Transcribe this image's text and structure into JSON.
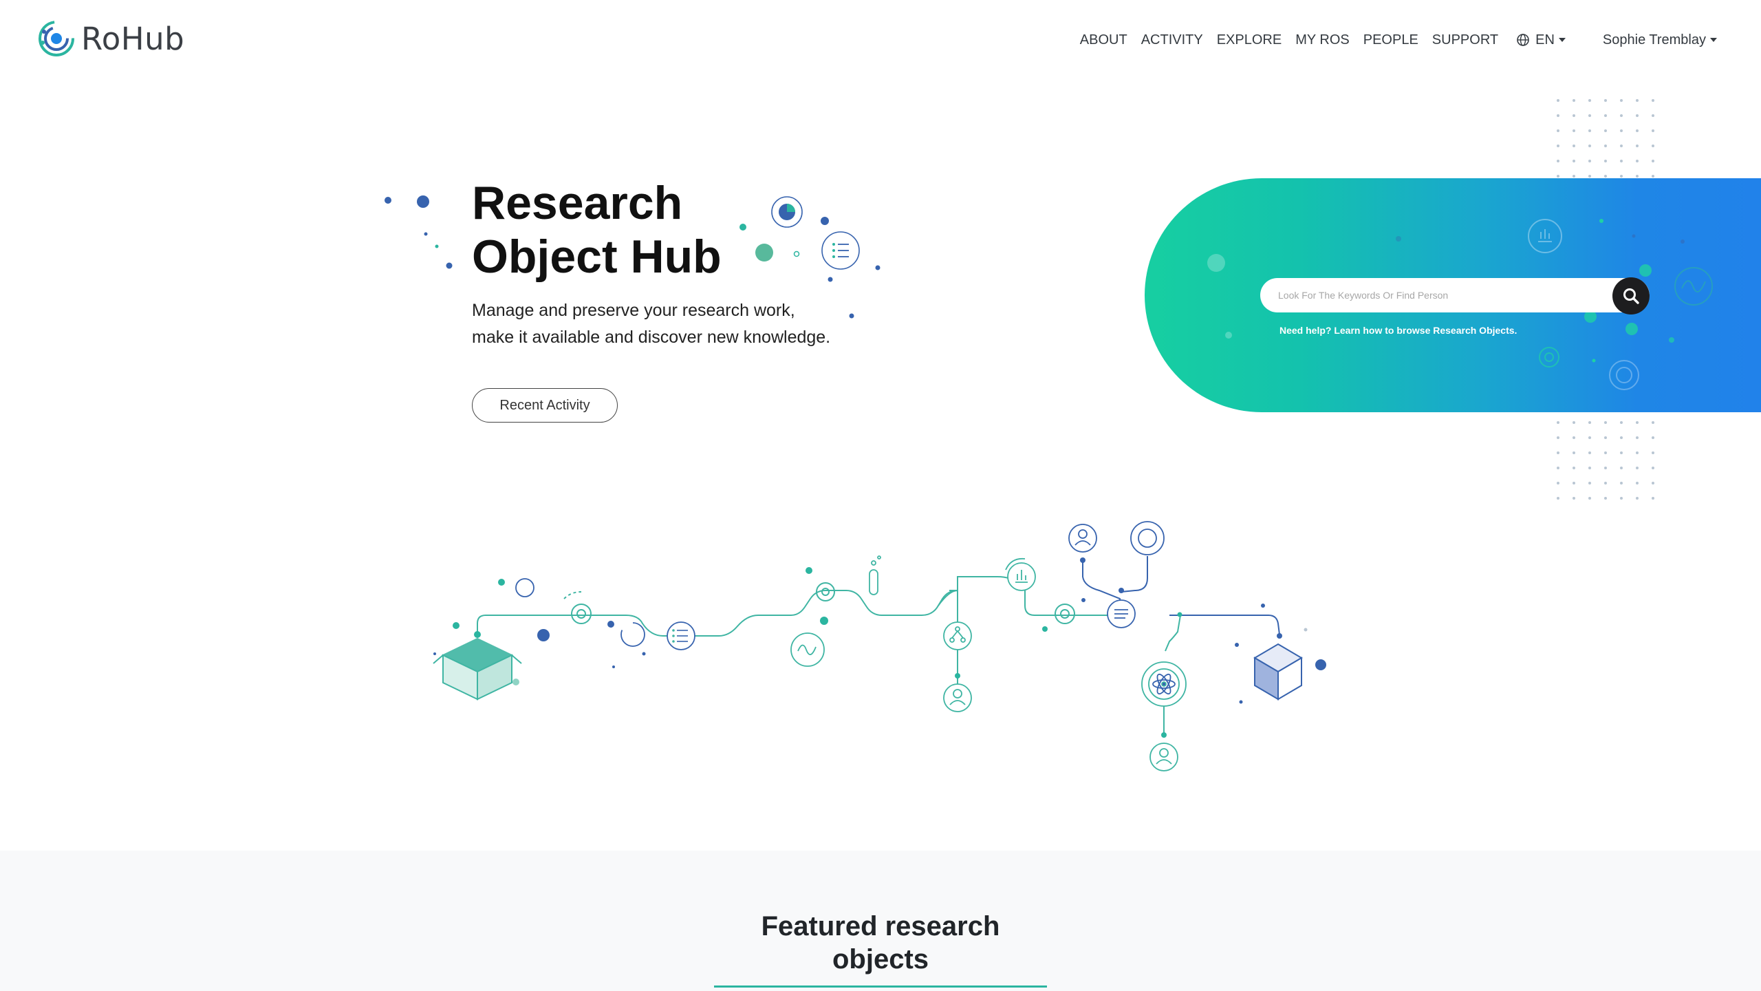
{
  "brand": {
    "name": "RoHub"
  },
  "nav": {
    "links": [
      {
        "label": "ABOUT"
      },
      {
        "label": "ACTIVITY"
      },
      {
        "label": "EXPLORE"
      },
      {
        "label": "MY ROS"
      },
      {
        "label": "PEOPLE"
      },
      {
        "label": "SUPPORT"
      }
    ],
    "language": "EN",
    "user": "Sophie Tremblay"
  },
  "hero": {
    "title_line1": "Research",
    "title_line2": "Object Hub",
    "subtitle_line1": "Manage and preserve your research work,",
    "subtitle_line2": "make it available and discover new knowledge.",
    "cta": "Recent Activity"
  },
  "search": {
    "placeholder": "Look For The Keywords Or Find Person",
    "help": "Need help? Learn how to browse Research Objects."
  },
  "featured": {
    "title_line1": "Featured research",
    "title_line2": "objects"
  },
  "colors": {
    "teal": "#2bb5a0",
    "blue": "#3763ae",
    "gradient_start": "#17cfa1",
    "gradient_end": "#2182ea"
  }
}
